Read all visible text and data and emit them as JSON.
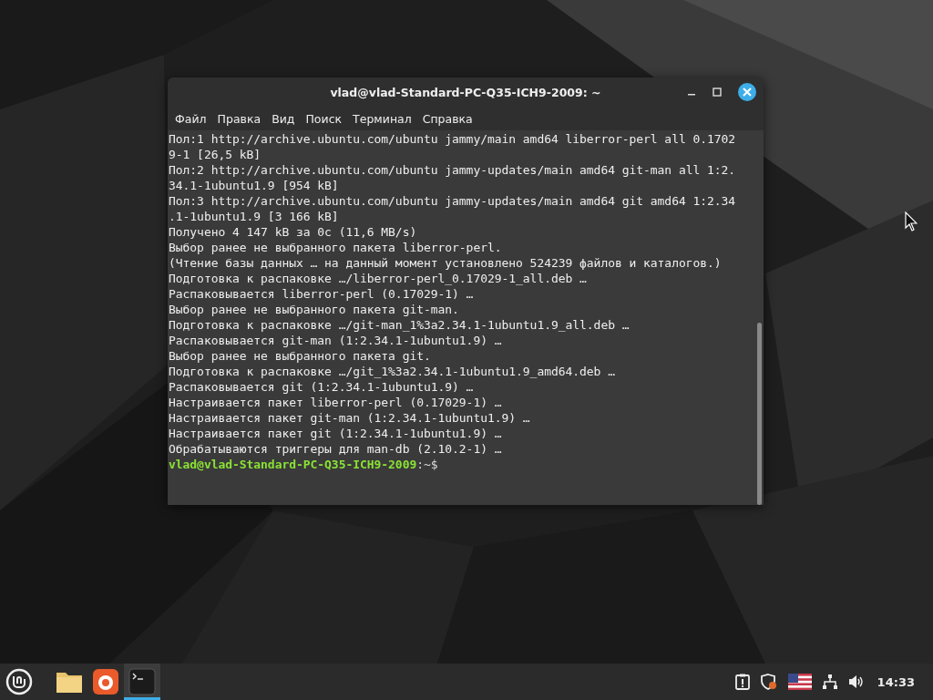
{
  "terminal": {
    "title": "vlad@vlad-Standard-PC-Q35-ICH9-2009: ~",
    "menu": [
      "Файл",
      "Правка",
      "Вид",
      "Поиск",
      "Терминал",
      "Справка"
    ],
    "lines": [
      "Пол:1 http://archive.ubuntu.com/ubuntu jammy/main amd64 liberror-perl all 0.1702",
      "9-1 [26,5 kB]",
      "Пол:2 http://archive.ubuntu.com/ubuntu jammy-updates/main amd64 git-man all 1:2.",
      "34.1-1ubuntu1.9 [954 kB]",
      "Пол:3 http://archive.ubuntu.com/ubuntu jammy-updates/main amd64 git amd64 1:2.34",
      ".1-1ubuntu1.9 [3 166 kB]",
      "Получено 4 147 kB за 0c (11,6 MB/s)",
      "Выбор ранее не выбранного пакета liberror-perl.",
      "(Чтение базы данных … на данный момент установлено 524239 файлов и каталогов.)",
      "Подготовка к распаковке …/liberror-perl_0.17029-1_all.deb …",
      "Распаковывается liberror-perl (0.17029-1) …",
      "Выбор ранее не выбранного пакета git-man.",
      "Подготовка к распаковке …/git-man_1%3a2.34.1-1ubuntu1.9_all.deb …",
      "Распаковывается git-man (1:2.34.1-1ubuntu1.9) …",
      "Выбор ранее не выбранного пакета git.",
      "Подготовка к распаковке …/git_1%3a2.34.1-1ubuntu1.9_amd64.deb …",
      "Распаковывается git (1:2.34.1-1ubuntu1.9) …",
      "Настраивается пакет liberror-perl (0.17029-1) …",
      "Настраивается пакет git-man (1:2.34.1-1ubuntu1.9) …",
      "Настраивается пакет git (1:2.34.1-1ubuntu1.9) …",
      "Обрабатываются триггеры для man-db (2.10.2-1) …"
    ],
    "prompt": {
      "user_host": "vlad@vlad-Standard-PC-Q35-ICH9-2009",
      "path": ":~$"
    }
  },
  "taskbar": {
    "apps": [
      {
        "kind": "folder",
        "active": false
      },
      {
        "kind": "browser",
        "active": false
      },
      {
        "kind": "terminal",
        "active": true
      }
    ],
    "clock": "14:33"
  }
}
